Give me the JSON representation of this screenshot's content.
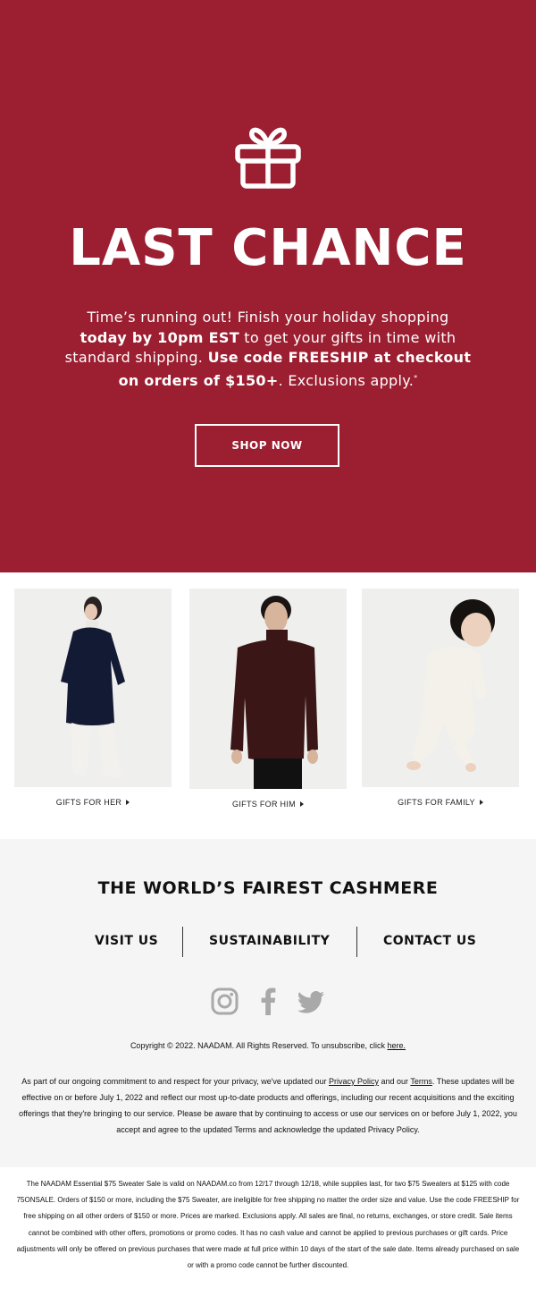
{
  "hero": {
    "background": "#9b1e31",
    "icon": "gift-icon",
    "title": "LAST CHANCE",
    "copy_1": "Time’s running out! Finish your holiday shopping",
    "copy_2_bold": "today by 10pm EST",
    "copy_2_rest": " to get your gifts in time with",
    "copy_3": "standard shipping. ",
    "copy_3_bold": "Use code FREESHIP at checkout",
    "copy_4_bold": "on orders of $150+",
    "copy_4_rest": ". Exclusions apply.",
    "copy_sup": "*",
    "cta_label": "SHOP NOW"
  },
  "products": [
    {
      "label": "GIFTS FOR HER"
    },
    {
      "label": "GIFTS FOR HIM"
    },
    {
      "label": "GIFTS FOR FAMILY"
    }
  ],
  "footer": {
    "heading": "THE WORLD’S FAIREST CASHMERE",
    "nav": [
      "VISIT US",
      "SUSTAINABILITY",
      "CONTACT US"
    ],
    "social_icons": [
      "instagram-icon",
      "facebook-icon",
      "twitter-icon"
    ],
    "copyright_text": "Copyright © 2022. NAADAM. All Rights Reserved. To unsubscribe, click ",
    "unsubscribe_link": "here.",
    "privacy_1": "As part of our ongoing commitment to and respect for your privacy, we've updated our ",
    "privacy_link": "Privacy Policy",
    "privacy_2": " and our ",
    "terms_link": "Terms",
    "privacy_3": ". These updates will be effective on or before July 1, 2022 and reflect our most up-to-date products and offerings, including our recent acquisitions and the exciting offerings that they're bringing to our service. Please be aware that by continuing to access or use our services on or before July 1, 2022, you accept and agree to the updated Terms and acknowledge the updated Privacy Policy."
  },
  "terms_text": "The NAADAM Essential $75 Sweater Sale is valid on NAADAM.co from 12/17 through 12/18, while supplies last, for two $75 Sweaters at $125 with code 75ONSALE. Orders of $150 or more, including the $75 Sweater, are ineligible for free shipping no matter the order size and value. Use the code FREESHIP for free shipping on all other orders of $150 or more. Prices are marked. Exclusions apply. All sales are final, no returns, exchanges, or store credit. Sale items cannot be combined with other offers, promotions or promo codes. It has no cash value and cannot be applied to previous purchases or gift cards. Price adjustments will only be offered on previous purchases that were made at full price within 10 days of the start of the sale date. Items already purchased on sale or with a promo code cannot be further discounted."
}
